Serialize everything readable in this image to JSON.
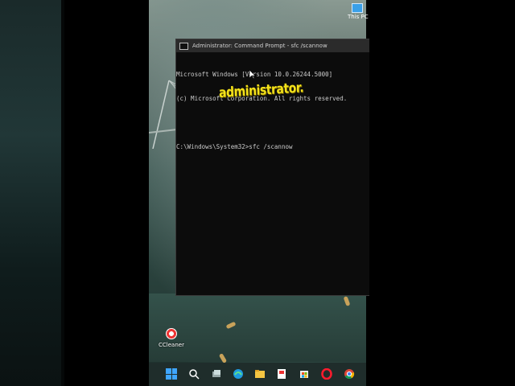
{
  "desktop": {
    "icons": [
      {
        "label": "This PC"
      },
      {
        "label": "CCleaner"
      }
    ]
  },
  "cmd_window": {
    "title": "Administrator: Command Prompt - sfc  /scannow",
    "lines": [
      "Microsoft Windows [Version 10.0.26244.5000]",
      "(c) Microsoft Corporation. All rights reserved.",
      "",
      "C:\\Windows\\System32>sfc /scannow"
    ]
  },
  "overlay": {
    "caption": "administrator."
  },
  "taskbar": {
    "items": [
      "start-icon",
      "search-icon",
      "task-view-icon",
      "edge-icon",
      "file-explorer-icon",
      "app-icon",
      "store-icon",
      "opera-icon",
      "chrome-icon"
    ]
  },
  "colors": {
    "caption": "#f4e21a",
    "console_bg": "#0c0c0c",
    "console_text": "#cccccc",
    "accent": "#3fa6ff"
  }
}
